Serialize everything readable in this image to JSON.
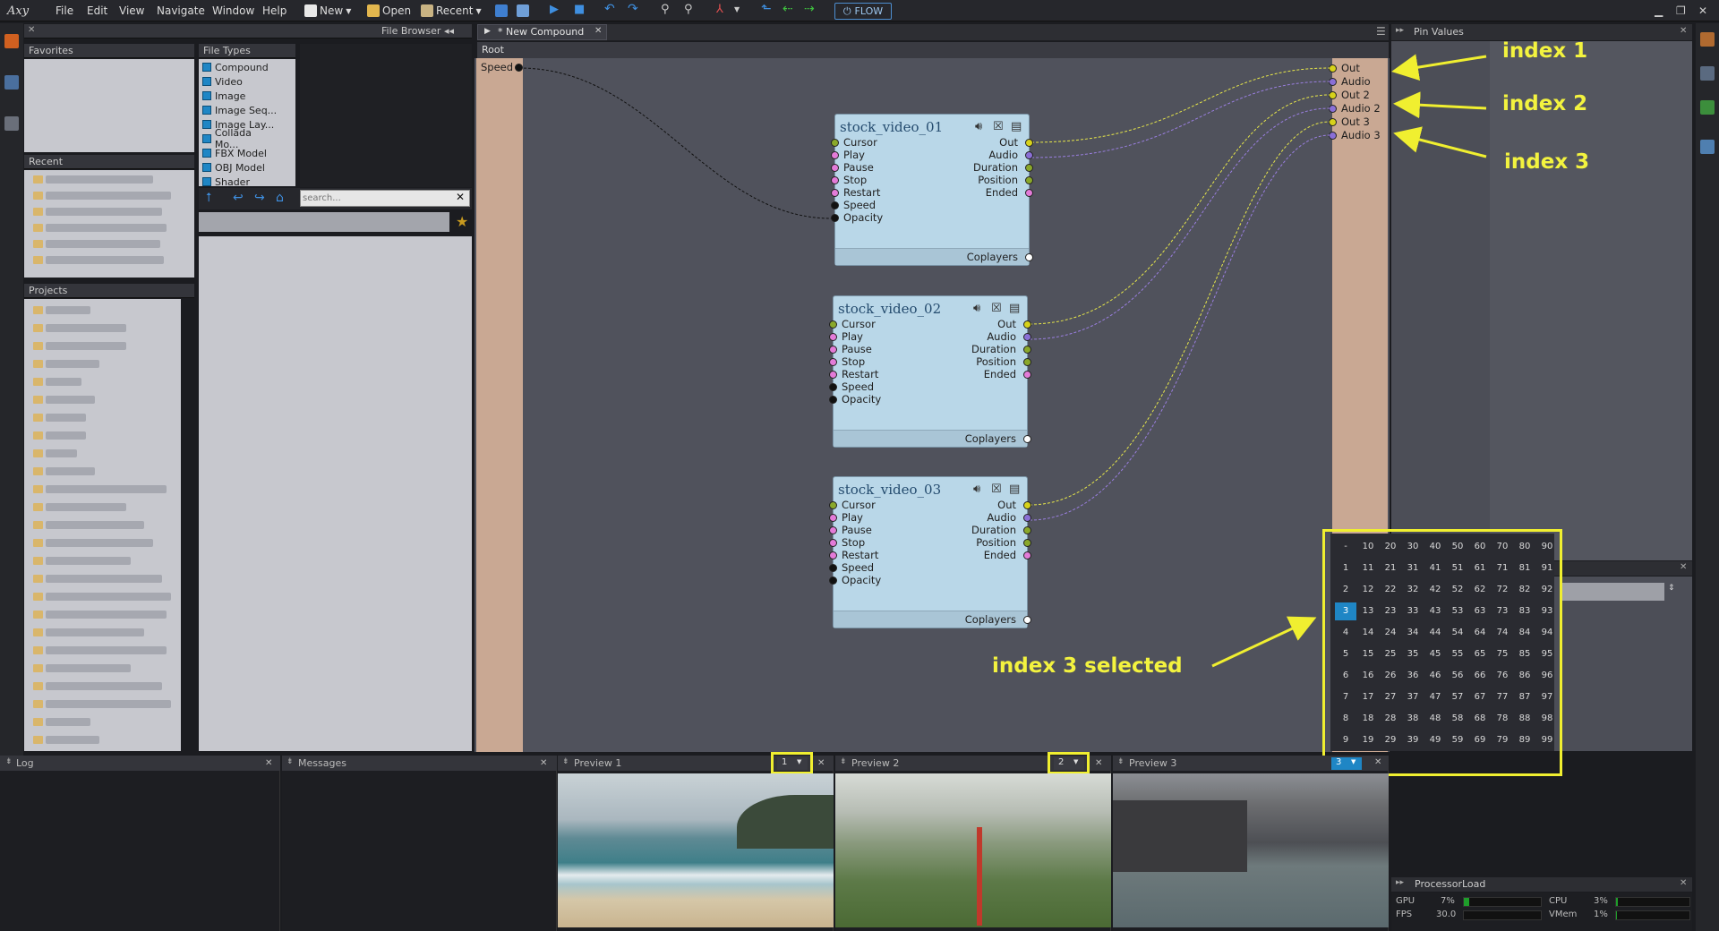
{
  "app": {
    "logo": "Axy"
  },
  "menu": [
    "File",
    "Edit",
    "View",
    "Navigate",
    "Window",
    "Help"
  ],
  "toolbar": {
    "new": "New",
    "open": "Open",
    "recent": "Recent",
    "flow": "FLOW"
  },
  "file_browser": {
    "title": "File Browser",
    "favorites": "Favorites",
    "file_types_title": "File Types",
    "file_types": [
      "Compound",
      "Video",
      "Image",
      "Image Seq...",
      "Image Lay...",
      "Collada Mo...",
      "FBX Model",
      "OBJ Model",
      "Shader"
    ],
    "recent": "Recent",
    "projects": "Projects",
    "search_placeholder": "search..."
  },
  "tab": {
    "label": "* New Compound"
  },
  "breadcrumb": "Root",
  "root_left_pin": "Speed",
  "root_right_pins": [
    "Out",
    "Audio",
    "Out 2",
    "Audio 2",
    "Out 3",
    "Audio 3"
  ],
  "nodes": [
    {
      "title": "stock_video_01",
      "inputs": [
        "Cursor",
        "Play",
        "Pause",
        "Stop",
        "Restart",
        "Speed",
        "Opacity"
      ],
      "outputs": [
        "Out",
        "Audio",
        "Duration",
        "Position",
        "Ended"
      ],
      "footer": "Coplayers"
    },
    {
      "title": "stock_video_02",
      "inputs": [
        "Cursor",
        "Play",
        "Pause",
        "Stop",
        "Restart",
        "Speed",
        "Opacity"
      ],
      "outputs": [
        "Out",
        "Audio",
        "Duration",
        "Position",
        "Ended"
      ],
      "footer": "Coplayers"
    },
    {
      "title": "stock_video_03",
      "inputs": [
        "Cursor",
        "Play",
        "Pause",
        "Stop",
        "Restart",
        "Speed",
        "Opacity"
      ],
      "outputs": [
        "Out",
        "Audio",
        "Duration",
        "Position",
        "Ended"
      ],
      "footer": "Coplayers"
    }
  ],
  "pin_values": {
    "title": "Pin Values"
  },
  "annotations": {
    "i1": "index 1",
    "i2": "index 2",
    "i3": "index 3",
    "sel": "index 3 selected"
  },
  "index_grid": {
    "selected": "3",
    "dash": "-",
    "selector_value": "3"
  },
  "bottom": {
    "log": "Log",
    "messages": "Messages",
    "preview1": "Preview 1",
    "preview1_index": "1",
    "preview2": "Preview 2",
    "preview2_index": "2",
    "preview3": "Preview 3"
  },
  "processor": {
    "title": "ProcessorLoad",
    "gpu_label": "GPU",
    "gpu": "7%",
    "gpu_level": 0.07,
    "fps_label": "FPS",
    "fps": "30.0",
    "cpu_label": "CPU",
    "cpu": "3%",
    "cpu_level": 0.03,
    "vmem_label": "VMem",
    "vmem": "1%",
    "vmem_level": 0.01
  },
  "colors": {
    "accent": "#f0ef30",
    "node": "#b9d7e8",
    "strip": "#c9a893",
    "canvas": "#50525c"
  }
}
